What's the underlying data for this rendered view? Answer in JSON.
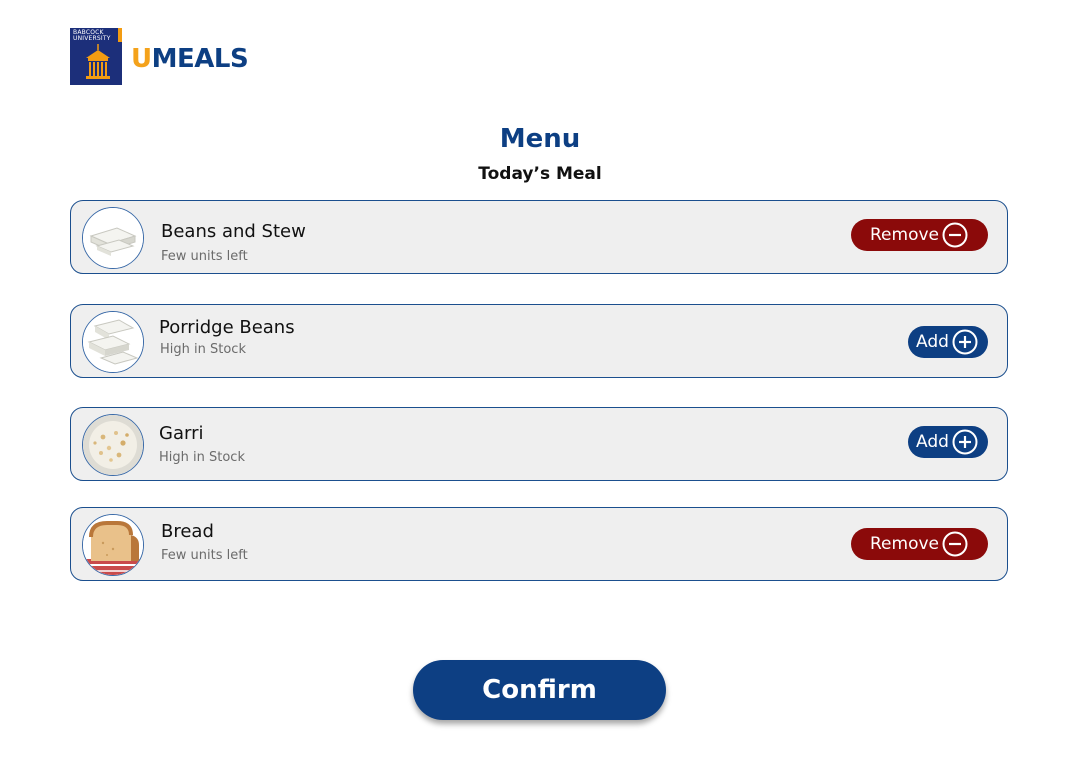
{
  "header": {
    "badge_text_line1": "BABCOCK",
    "badge_text_line2": "UNIVERSITY",
    "brand_first": "U",
    "brand_rest": "MEALS"
  },
  "menu": {
    "title": "Menu",
    "subtitle": "Today’s Meal"
  },
  "meals": [
    {
      "name": "Beans and Stew",
      "stock": "Few units left",
      "action_label": "Remove",
      "action": "remove",
      "image": "white-blocks-food-icon"
    },
    {
      "name": "Porridge Beans",
      "stock": "High in Stock",
      "action_label": "Add",
      "action": "add",
      "image": "white-blocks-food-icon"
    },
    {
      "name": "Garri",
      "stock": "High in Stock",
      "action_label": "Add",
      "action": "add",
      "image": "garri-bowl-icon"
    },
    {
      "name": "Bread",
      "stock": "Few units left",
      "action_label": "Remove",
      "action": "remove",
      "image": "bread-loaf-icon"
    }
  ],
  "confirm": {
    "label": "Confirm"
  },
  "colors": {
    "primary": "#0d3f83",
    "accent": "#f4a21b",
    "remove": "#8b0a0a",
    "card_bg": "#efefef"
  }
}
